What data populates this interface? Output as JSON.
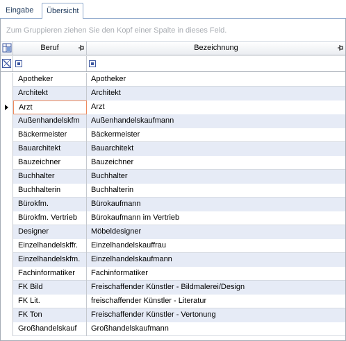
{
  "tabs": [
    {
      "label": "Eingabe",
      "active": false
    },
    {
      "label": "Übersicht",
      "active": true
    }
  ],
  "group_panel": {
    "hint": "Zum Gruppieren ziehen Sie den Kopf einer Spalte in dieses Feld."
  },
  "columns": [
    {
      "label": "Beruf",
      "icon": "pin-icon"
    },
    {
      "label": "Bezeichnung",
      "icon": "pin-icon"
    }
  ],
  "icons": {
    "column_chooser": "column-chooser-icon",
    "filter_clear": "filter-clear-icon",
    "filter_operator": "filter-operator-icon",
    "current_row": "row-indicator-arrow-icon"
  },
  "colors": {
    "tab_border": "#8ea8cc",
    "alt_row": "#e6ebf6",
    "focus_border": "#ee8a5e",
    "grid_line": "#c5c9cf"
  },
  "rows": [
    {
      "beruf": "Apotheker",
      "bezeichnung": "Apotheker"
    },
    {
      "beruf": "Architekt",
      "bezeichnung": "Architekt"
    },
    {
      "beruf": "Arzt",
      "bezeichnung": "Arzt",
      "current": true
    },
    {
      "beruf": "Außenhandelskfm",
      "bezeichnung": "Außenhandelskaufmann"
    },
    {
      "beruf": "Bäckermeister",
      "bezeichnung": "Bäckermeister"
    },
    {
      "beruf": "Bauarchitekt",
      "bezeichnung": "Bauarchitekt"
    },
    {
      "beruf": "Bauzeichner",
      "bezeichnung": "Bauzeichner"
    },
    {
      "beruf": "Buchhalter",
      "bezeichnung": "Buchhalter"
    },
    {
      "beruf": "Buchhalterin",
      "bezeichnung": "Buchhalterin"
    },
    {
      "beruf": "Bürokfm.",
      "bezeichnung": "Bürokaufmann"
    },
    {
      "beruf": "Bürokfm. Vertrieb",
      "bezeichnung": "Bürokaufmann im Vertrieb"
    },
    {
      "beruf": "Designer",
      "bezeichnung": "Möbeldesigner"
    },
    {
      "beruf": "Einzelhandelskffr.",
      "bezeichnung": "Einzelhandelskauffrau"
    },
    {
      "beruf": "Einzelhandelskfm.",
      "bezeichnung": "Einzelhandelskaufmann"
    },
    {
      "beruf": "Fachinformatiker",
      "bezeichnung": "Fachinformatiker"
    },
    {
      "beruf": "FK Bild",
      "bezeichnung": "Freischaffender Künstler - Bildmalerei/Design"
    },
    {
      "beruf": "FK Lit.",
      "bezeichnung": "freischaffender Künstler - Literatur"
    },
    {
      "beruf": "FK Ton",
      "bezeichnung": "Freischaffender Künstler - Vertonung"
    },
    {
      "beruf": "Großhandelskauf",
      "bezeichnung": "Großhandelskaufmann"
    }
  ]
}
